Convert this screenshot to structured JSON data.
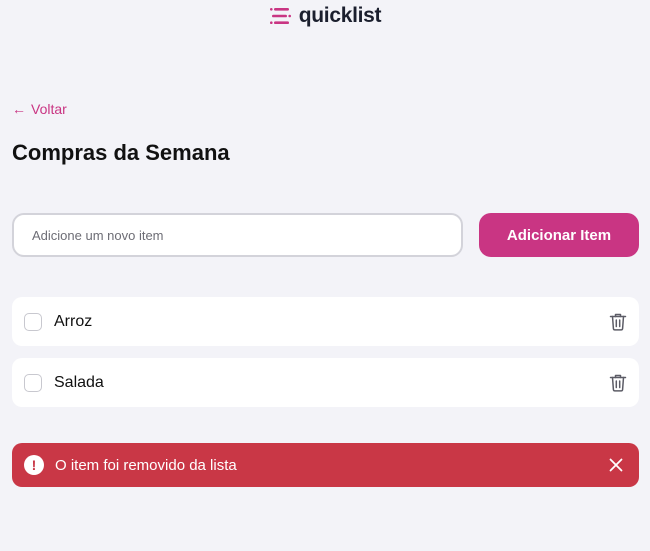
{
  "header": {
    "logo_text": "quicklist",
    "logo_icon": "list-icon",
    "brand_color": "#c93583"
  },
  "nav": {
    "back_arrow": "←",
    "back_label": "Voltar"
  },
  "main": {
    "title": "Compras da Semana",
    "input": {
      "placeholder": "Adicione um novo item",
      "value": ""
    },
    "add_button_label": "Adicionar Item",
    "items": [
      {
        "label": "Arroz",
        "checked": false,
        "icon": "trash-icon"
      },
      {
        "label": "Salada",
        "checked": false,
        "icon": "trash-icon"
      }
    ]
  },
  "alert": {
    "icon_glyph": "!",
    "icon": "warning-icon",
    "message": "O item foi removido da lista",
    "close_icon": "close-icon",
    "color": "#c93746"
  }
}
